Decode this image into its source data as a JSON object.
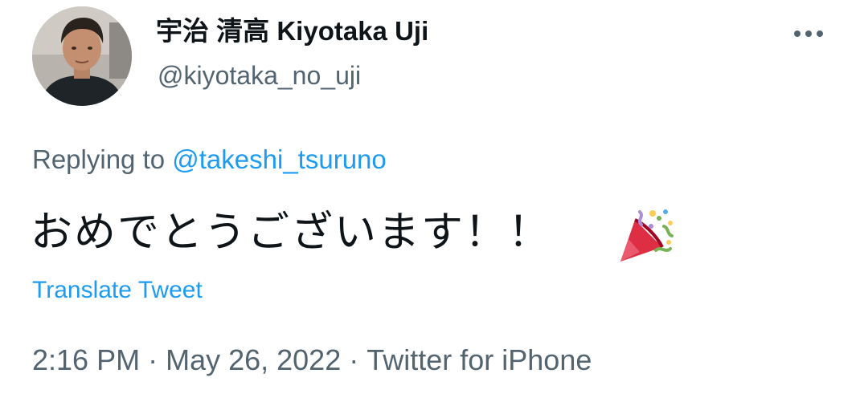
{
  "author": {
    "display_name": "宇治 清高 Kiyotaka Uji",
    "handle": "@kiyotaka_no_uji",
    "avatar_icon": "profile-photo"
  },
  "more_icon": "more-horizontal-icon",
  "reply": {
    "prefix": "Replying to ",
    "mention": "@takeshi_tsuruno"
  },
  "tweet": {
    "text": "おめでとうございます！！",
    "emoji_icon": "party-popper-icon"
  },
  "translate_label": "Translate Tweet",
  "meta": {
    "time": "2:16 PM",
    "separator": "·",
    "date": "May 26, 2022",
    "source": "Twitter for iPhone"
  },
  "colors": {
    "text": "#0f1419",
    "secondary": "#536471",
    "link": "#1d9bf0"
  }
}
